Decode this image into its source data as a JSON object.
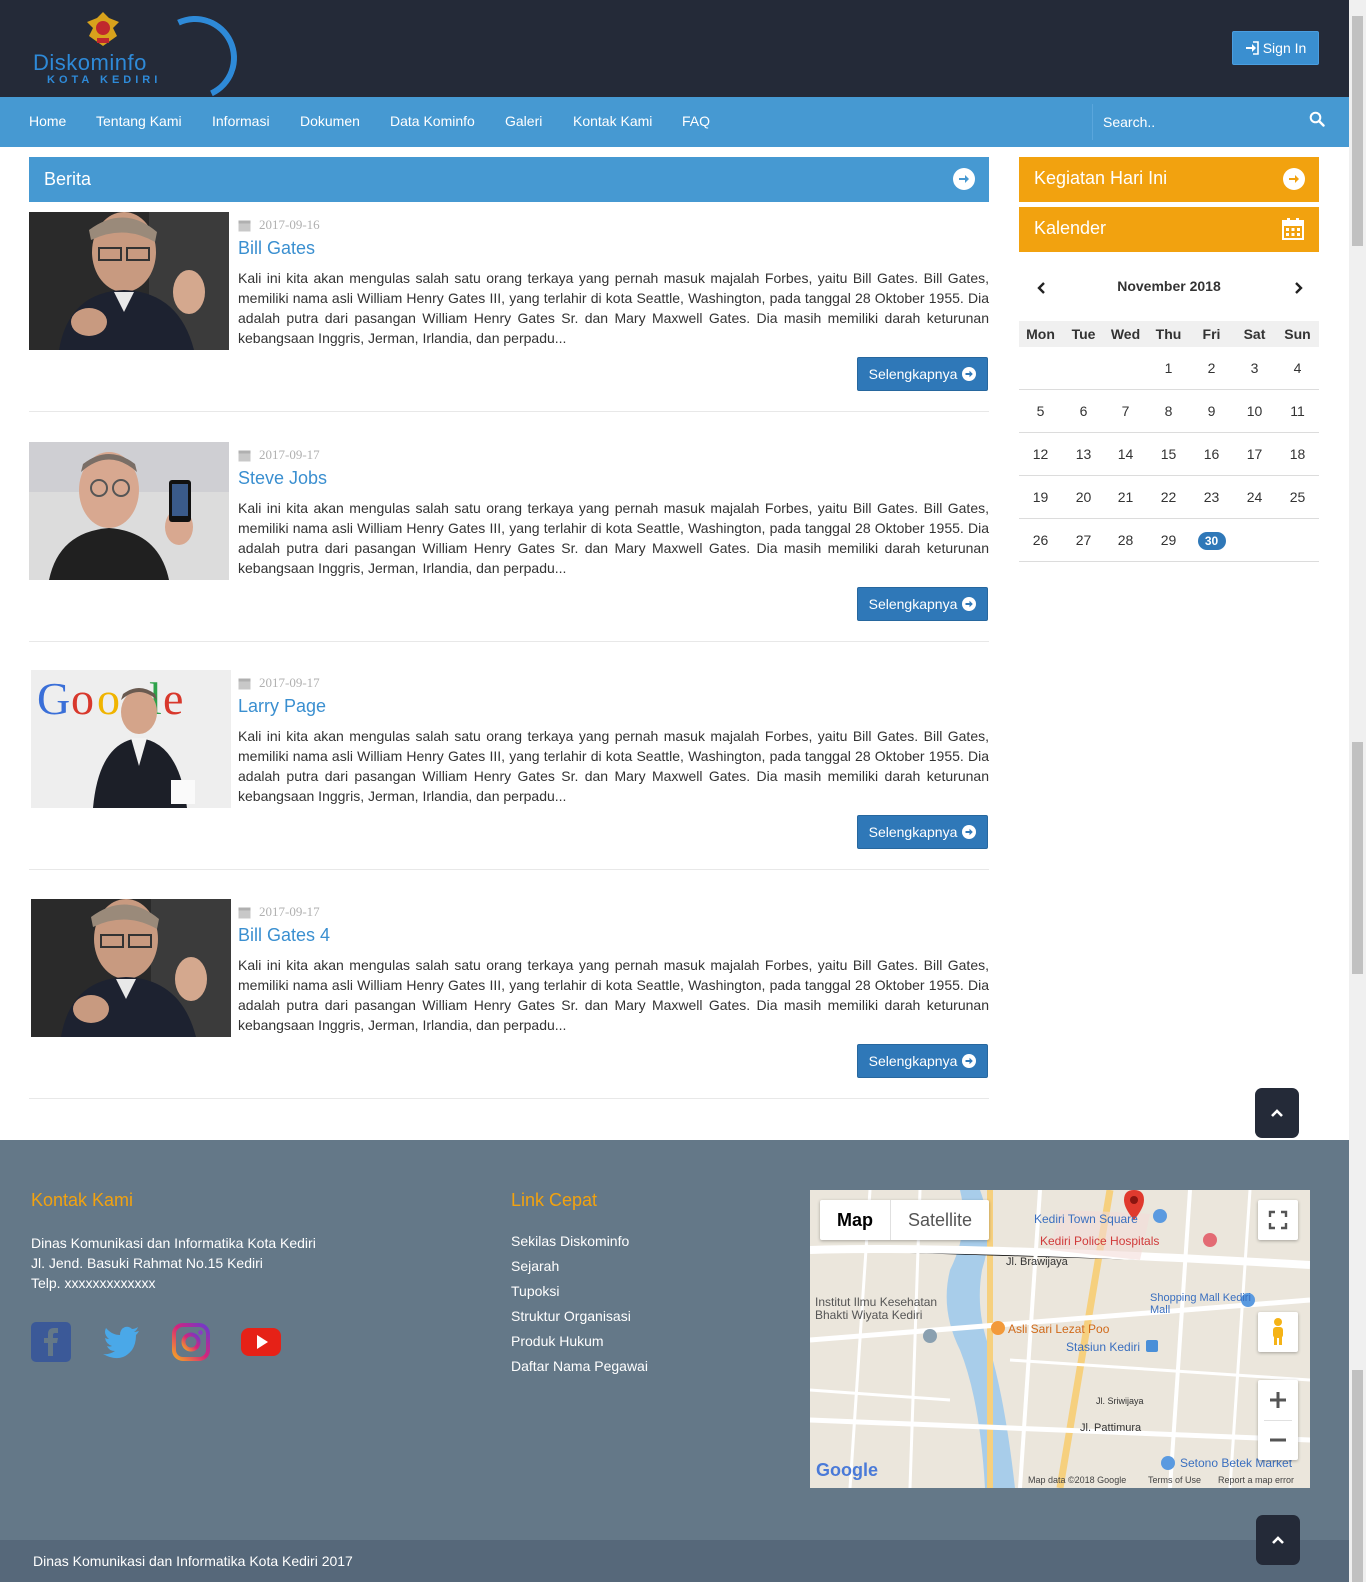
{
  "header": {
    "logo_text": "Diskominfo",
    "logo_sub": "KOTA KEDIRI",
    "signin_label": "Sign In"
  },
  "nav": {
    "items": [
      "Home",
      "Tentang Kami",
      "Informasi",
      "Dokumen",
      "Data Kominfo",
      "Galeri",
      "Kontak Kami",
      "FAQ"
    ],
    "search_placeholder": "Search.."
  },
  "berita": {
    "title": "Berita",
    "more_label": "Selengkapnya",
    "items": [
      {
        "date": "2017-09-16",
        "title": "Bill Gates",
        "excerpt": "Kali ini kita akan mengulas salah satu orang terkaya yang pernah masuk majalah Forbes, yaitu Bill Gates. Bill Gates, memiliki nama asli William Henry Gates III, yang terlahir di kota Seattle, Washington, pada tanggal 28 Oktober 1955. Dia adalah putra dari pasangan William Henry Gates Sr. dan Mary Maxwell Gates. Dia masih memiliki darah keturunan kebangsaan Inggris, Jerman, Irlandia, dan perpadu..."
      },
      {
        "date": "2017-09-17",
        "title": "Steve Jobs",
        "excerpt": "Kali ini kita akan mengulas salah satu orang terkaya yang pernah masuk majalah Forbes, yaitu Bill Gates. Bill Gates, memiliki nama asli William Henry Gates III, yang terlahir di kota Seattle, Washington, pada tanggal 28 Oktober 1955. Dia adalah putra dari pasangan William Henry Gates Sr. dan Mary Maxwell Gates. Dia masih memiliki darah keturunan kebangsaan Inggris, Jerman, Irlandia, dan perpadu..."
      },
      {
        "date": "2017-09-17",
        "title": "Larry Page",
        "excerpt": "Kali ini kita akan mengulas salah satu orang terkaya yang pernah masuk majalah Forbes, yaitu Bill Gates. Bill Gates, memiliki nama asli William Henry Gates III, yang terlahir di kota Seattle, Washington, pada tanggal 28 Oktober 1955. Dia adalah putra dari pasangan William Henry Gates Sr. dan Mary Maxwell Gates. Dia masih memiliki darah keturunan kebangsaan Inggris, Jerman, Irlandia, dan perpadu..."
      },
      {
        "date": "2017-09-17",
        "title": "Bill Gates 4",
        "excerpt": "Kali ini kita akan mengulas salah satu orang terkaya yang pernah masuk majalah Forbes, yaitu Bill Gates. Bill Gates, memiliki nama asli William Henry Gates III, yang terlahir di kota Seattle, Washington, pada tanggal 28 Oktober 1955. Dia adalah putra dari pasangan William Henry Gates Sr. dan Mary Maxwell Gates. Dia masih memiliki darah keturunan kebangsaan Inggris, Jerman, Irlandia, dan perpadu..."
      }
    ]
  },
  "sidebar": {
    "kegiatan_title": "Kegiatan Hari Ini",
    "kalender_title": "Kalender",
    "calendar": {
      "month_label": "November 2018",
      "weekdays": [
        "Mon",
        "Tue",
        "Wed",
        "Thu",
        "Fri",
        "Sat",
        "Sun"
      ],
      "weeks": [
        [
          "",
          "",
          "",
          "1",
          "2",
          "3",
          "4"
        ],
        [
          "5",
          "6",
          "7",
          "8",
          "9",
          "10",
          "11"
        ],
        [
          "12",
          "13",
          "14",
          "15",
          "16",
          "17",
          "18"
        ],
        [
          "19",
          "20",
          "21",
          "22",
          "23",
          "24",
          "25"
        ],
        [
          "26",
          "27",
          "28",
          "29",
          "30",
          "",
          ""
        ]
      ],
      "today": "30"
    }
  },
  "footer": {
    "kontak_title": "Kontak Kami",
    "kontak_lines": [
      "Dinas Komunikasi dan Informatika Kota Kediri",
      "Jl. Jend. Basuki Rahmat No.15 Kediri",
      "Telp. xxxxxxxxxxxxx"
    ],
    "link_title": "Link Cepat",
    "links": [
      "Sekilas Diskominfo",
      "Sejarah",
      "Tupoksi",
      "Struktur Organisasi",
      "Produk Hukum",
      "Daftar Nama Pegawai"
    ],
    "copyright": "Dinas Komunikasi dan Informatika Kota Kediri 2017",
    "map": {
      "tab_map": "Map",
      "tab_satellite": "Satellite",
      "places": [
        "Kediri Town Square",
        "Kediri Police Hospitals",
        "Jl. Brawijaya",
        "Shopping Mall Kediri Mall",
        "Institut Ilmu Kesehatan Bhakti Wiyata Kediri",
        "Asli Sari Lezat Poo",
        "Stasiun Kediri",
        "Jl. Sriwijaya",
        "Jl. Pattimura",
        "Setono Betek Market"
      ],
      "footer_text": "Map data ©2018 Google",
      "terms": "Terms of Use",
      "report": "Report a map error",
      "google": "Google"
    }
  },
  "colors": {
    "header_bg": "#242a38",
    "nav_bg": "#4699d2",
    "accent_orange": "#f2a20f",
    "button_blue": "#2f78b8",
    "footer_bg": "#647888"
  }
}
